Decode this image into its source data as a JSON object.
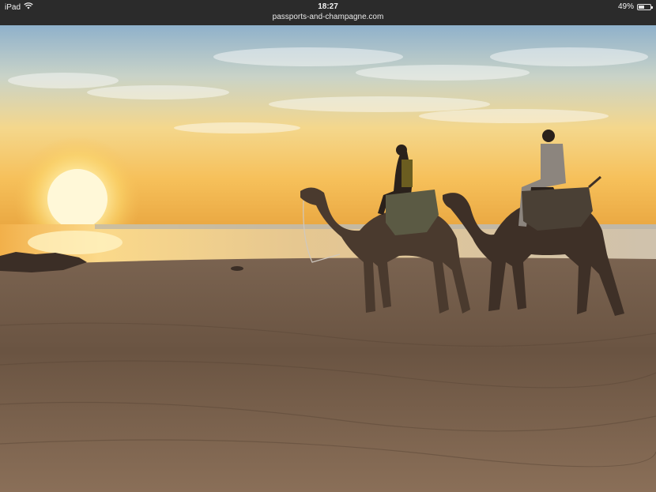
{
  "status_bar": {
    "device": "iPad",
    "time": "18:27",
    "url": "passports-and-champagne.com",
    "battery_percent": "49%",
    "battery_level": 0.49,
    "wifi_icon": "wifi-icon",
    "battery_icon": "battery-icon"
  },
  "photo": {
    "sky_top": "#9ab8cf",
    "sun_color": "#fff4c0",
    "sand_color": "#6e5844",
    "silhouette_color": "#3a2b22"
  }
}
